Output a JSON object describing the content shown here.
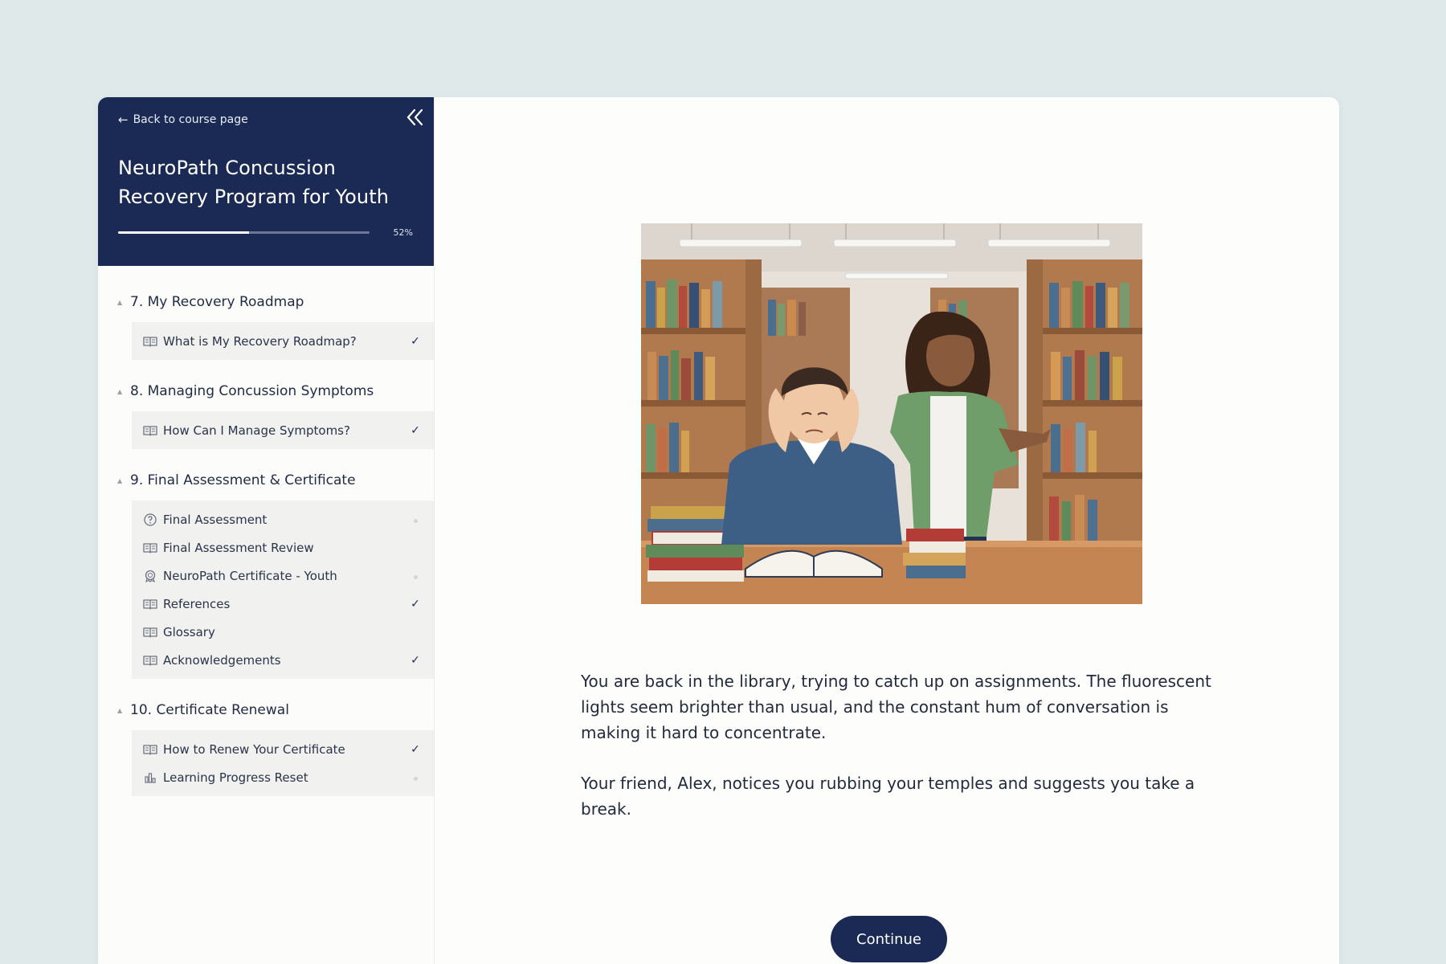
{
  "sidebar": {
    "back_label": "Back to course page",
    "course_title": "NeuroPath Concussion Recovery Program for Youth",
    "progress": {
      "percent_label": "52%",
      "fraction": 0.52
    },
    "sections": [
      {
        "title": "7. My Recovery Roadmap",
        "lessons": [
          {
            "label": "What is My Recovery Roadmap?",
            "icon": "book-icon",
            "status": "complete"
          }
        ]
      },
      {
        "title": "8. Managing Concussion Symptoms",
        "lessons": [
          {
            "label": "How Can I Manage Symptoms?",
            "icon": "book-icon",
            "status": "complete"
          }
        ]
      },
      {
        "title": "9. Final Assessment & Certificate",
        "lessons": [
          {
            "label": "Final Assessment",
            "icon": "question-circle-icon",
            "status": "incomplete"
          },
          {
            "label": "Final Assessment Review",
            "icon": "book-icon",
            "status": "none"
          },
          {
            "label": "NeuroPath Certificate - Youth",
            "icon": "award-icon",
            "status": "incomplete"
          },
          {
            "label": "References",
            "icon": "book-icon",
            "status": "complete"
          },
          {
            "label": "Glossary",
            "icon": "book-icon",
            "status": "none"
          },
          {
            "label": "Acknowledgements",
            "icon": "book-icon",
            "status": "complete"
          }
        ]
      },
      {
        "title": "10. Certificate Renewal",
        "lessons": [
          {
            "label": "How to Renew Your Certificate",
            "icon": "book-icon",
            "status": "complete"
          },
          {
            "label": "Learning Progress Reset",
            "icon": "bar-chart-icon",
            "status": "incomplete"
          }
        ]
      }
    ]
  },
  "main": {
    "paragraphs": [
      "You are back in the library, trying to catch up on assignments. The fluorescent lights seem brighter than usual, and the constant hum of conversation is making it hard to concentrate.",
      "Your friend, Alex, notices you rubbing your temples and suggests you take a break."
    ],
    "continue_label": "Continue"
  },
  "colors": {
    "page_bg": "#dfe9ea",
    "navy": "#1b2a55",
    "lesson_bg": "#f1f1ef"
  }
}
